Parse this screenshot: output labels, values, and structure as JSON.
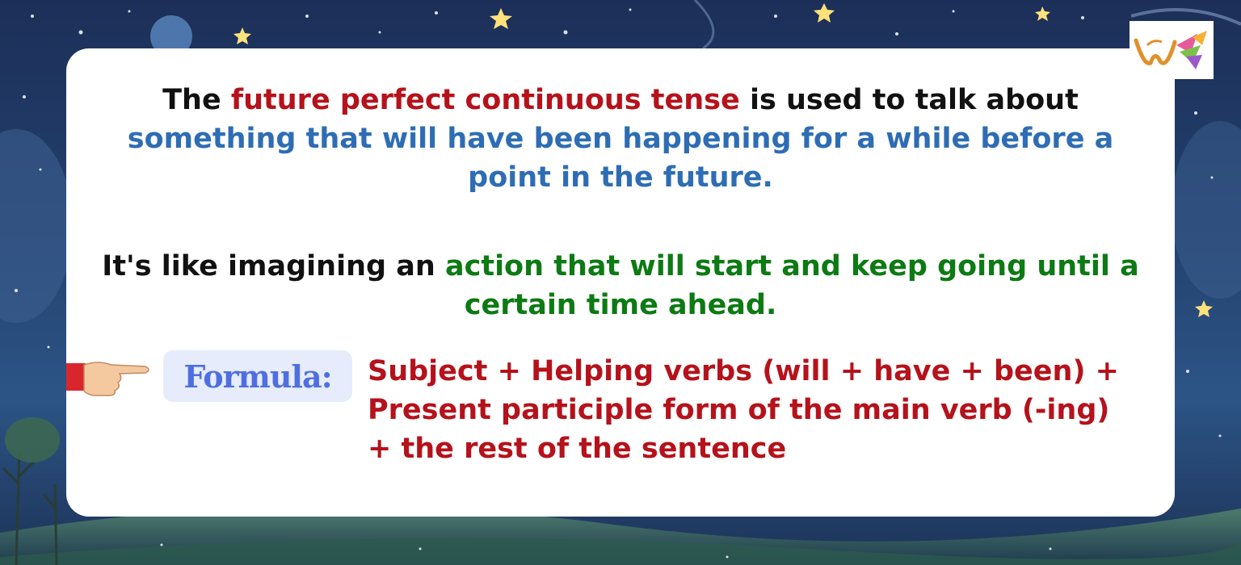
{
  "intro": {
    "line_a_before": "The ",
    "line_a_highlight": "future perfect continuous tense",
    "line_a_after": " is used to talk about",
    "line_b_highlight": "something that will have been happening for a while before a point in the future."
  },
  "simile": {
    "before": "It's like imagining an ",
    "highlight": "action that will start and keep going until a certain time ahead."
  },
  "formula": {
    "label": "Formula:",
    "line1": "Subject + Helping verbs (will + have + been) +",
    "line2": "Present participle form of the main verb (-ing)",
    "line3": "+ the rest of the sentence"
  },
  "icons": {
    "pointer": "pointing-hand-icon",
    "logo": "brand-logo"
  },
  "colors": {
    "tense_highlight": "#b5121b",
    "definition_highlight": "#2e6db4",
    "action_highlight": "#0d7a14",
    "formula_text": "#b5121b",
    "formula_label": "#4f6fe0",
    "formula_label_bg": "#e6ecfb"
  }
}
